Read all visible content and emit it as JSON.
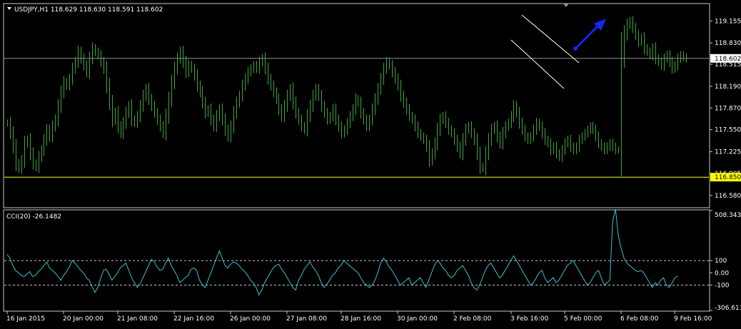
{
  "window": {
    "symbol_header": "USDJPY,H1  118.629 118.630 118.591 118.602",
    "menu_arrow": "triangle-down-icon"
  },
  "colors": {
    "background": "#000000",
    "frame": "#C8C8C8",
    "text": "#FFFFFF",
    "candles": "#3FA33F",
    "cci_line": "#3DBFD0",
    "bid_line": "#8C9199",
    "support_line": "#FFFF00",
    "support_label_bg": "#FFFF00",
    "support_label_text": "#000000",
    "bid_label_bg": "#FFFFFF",
    "bid_label_text": "#000000",
    "channel_lines": "#FFFFFF",
    "arrow": "#1428F0",
    "level_lines": "#C8C8C8"
  },
  "chart_data": [
    {
      "type": "bar",
      "symbol": "USDJPY",
      "timeframe": "H1",
      "ohlc_last": {
        "open": 118.629,
        "high": 118.63,
        "low": 118.591,
        "close": 118.602
      },
      "ylim": [
        116.41,
        119.4
      ],
      "y_ticks": [
        "119.155",
        "118.830",
        "118.515",
        "118.190",
        "117.870",
        "117.550",
        "117.225",
        "116.905",
        "116.580"
      ],
      "y_tick_values": [
        119.155,
        118.83,
        118.515,
        118.19,
        117.87,
        117.55,
        117.225,
        116.905,
        116.58
      ],
      "bid_level": 118.602,
      "bid_label": "118.602",
      "support_level": 116.85,
      "support_label": "116.850",
      "x_ticks": [
        "16 Jan 2015",
        "20 Jan 00:00",
        "21 Jan 08:00",
        "22 Jan 16:00",
        "26 Jan 00:00",
        "27 Jan 08:00",
        "28 Jan 16:00",
        "30 Jan 00:00",
        "2 Feb 08:00",
        "3 Feb 16:00",
        "5 Feb 00:00",
        "6 Feb 08:00",
        "9 Feb 16:00"
      ],
      "x_tick_index": [
        0,
        20,
        39,
        59,
        79,
        99,
        118,
        138,
        158,
        178,
        197,
        217,
        236
      ],
      "bar_count": 248,
      "series_close": [
        117.65,
        117.5,
        117.3,
        117.05,
        116.98,
        117.1,
        117.35,
        117.4,
        117.2,
        117.05,
        117.0,
        117.15,
        117.25,
        117.4,
        117.55,
        117.45,
        117.6,
        117.7,
        117.9,
        118.1,
        118.25,
        118.2,
        118.3,
        118.45,
        118.55,
        118.7,
        118.6,
        118.5,
        118.4,
        118.6,
        118.75,
        118.7,
        118.65,
        118.55,
        118.45,
        118.2,
        117.95,
        117.7,
        117.8,
        117.6,
        117.5,
        117.65,
        117.8,
        117.9,
        117.7,
        117.65,
        117.75,
        117.9,
        118.05,
        118.15,
        118.0,
        117.9,
        117.8,
        117.7,
        117.6,
        117.5,
        117.75,
        118.0,
        118.25,
        118.45,
        118.6,
        118.7,
        118.55,
        118.4,
        118.5,
        118.45,
        118.35,
        118.2,
        118.1,
        117.95,
        117.8,
        117.85,
        117.7,
        117.6,
        117.75,
        117.85,
        117.7,
        117.55,
        117.45,
        117.6,
        117.8,
        117.95,
        118.05,
        118.2,
        118.3,
        118.4,
        118.45,
        118.5,
        118.45,
        118.55,
        118.6,
        118.45,
        118.3,
        118.2,
        118.1,
        118.0,
        117.85,
        117.75,
        117.9,
        118.05,
        118.15,
        117.95,
        117.8,
        117.7,
        117.6,
        117.55,
        117.75,
        117.9,
        118.05,
        118.15,
        118.05,
        117.9,
        117.8,
        117.7,
        117.75,
        117.85,
        117.7,
        117.6,
        117.5,
        117.55,
        117.65,
        117.75,
        117.85,
        118.0,
        117.95,
        117.8,
        117.7,
        117.6,
        117.7,
        117.85,
        118.0,
        118.15,
        118.3,
        118.45,
        118.55,
        118.5,
        118.4,
        118.3,
        118.2,
        118.05,
        117.95,
        117.85,
        117.75,
        117.7,
        117.6,
        117.5,
        117.45,
        117.4,
        117.3,
        117.1,
        117.2,
        117.35,
        117.55,
        117.7,
        117.75,
        117.65,
        117.55,
        117.5,
        117.4,
        117.3,
        117.2,
        117.4,
        117.55,
        117.6,
        117.5,
        117.4,
        117.2,
        117.0,
        116.98,
        117.2,
        117.4,
        117.55,
        117.6,
        117.45,
        117.35,
        117.5,
        117.6,
        117.65,
        117.75,
        117.9,
        117.8,
        117.65,
        117.55,
        117.45,
        117.4,
        117.45,
        117.55,
        117.65,
        117.6,
        117.5,
        117.4,
        117.35,
        117.25,
        117.3,
        117.2,
        117.15,
        117.25,
        117.35,
        117.4,
        117.3,
        117.25,
        117.3,
        117.4,
        117.45,
        117.5,
        117.55,
        117.6,
        117.55,
        117.45,
        117.35,
        117.3,
        117.25,
        117.3,
        117.35,
        117.3,
        117.25,
        117.25,
        118.6,
        118.95,
        119.1,
        119.15,
        119.05,
        118.95,
        118.85,
        118.9,
        118.75,
        118.7,
        118.65,
        118.75,
        118.6,
        118.55,
        118.5,
        118.6,
        118.65,
        118.55,
        118.45,
        118.5,
        118.6,
        118.65,
        118.62,
        118.6
      ]
    },
    {
      "type": "line",
      "indicator": "CCI",
      "period": 20,
      "title": "CCI(20) -26.1482",
      "ylim": [
        -306.6117,
        508.3437
      ],
      "y_ticks": [
        "508.3437",
        "100",
        "0.00",
        "-100",
        "-306.6117"
      ],
      "y_tick_values": [
        508.3437,
        100,
        0,
        -100,
        -306.6117
      ],
      "levels": [
        100,
        -100
      ],
      "series_values": [
        150,
        120,
        60,
        20,
        0,
        -20,
        -30,
        -10,
        10,
        -30,
        -20,
        10,
        30,
        60,
        90,
        40,
        20,
        0,
        -30,
        -60,
        -20,
        10,
        50,
        100,
        80,
        50,
        20,
        0,
        -40,
        -60,
        -110,
        -160,
        -120,
        -50,
        20,
        30,
        -10,
        -60,
        -30,
        0,
        40,
        60,
        80,
        20,
        -40,
        -80,
        -120,
        -90,
        -40,
        10,
        60,
        110,
        90,
        50,
        20,
        30,
        80,
        120,
        60,
        20,
        -20,
        -80,
        -60,
        -40,
        -20,
        30,
        40,
        20,
        -60,
        -100,
        -120,
        -60,
        0,
        60,
        120,
        180,
        120,
        60,
        40,
        70,
        90,
        80,
        60,
        30,
        10,
        -20,
        -60,
        -80,
        -120,
        -180,
        -140,
        -80,
        -40,
        0,
        40,
        60,
        70,
        30,
        0,
        -40,
        -80,
        -120,
        -140,
        -60,
        -20,
        30,
        60,
        90,
        50,
        20,
        -20,
        -80,
        -120,
        -90,
        -60,
        -20,
        0,
        40,
        60,
        100,
        80,
        60,
        40,
        20,
        0,
        -40,
        -80,
        -100,
        -120,
        -100,
        -60,
        0,
        80,
        120,
        90,
        50,
        20,
        -20,
        -60,
        -100,
        -80,
        -60,
        -40,
        -100,
        -80,
        -60,
        -40,
        -80,
        -120,
        -60,
        0,
        60,
        100,
        80,
        40,
        20,
        -20,
        -40,
        -20,
        20,
        40,
        60,
        20,
        -20,
        -80,
        -120,
        -140,
        -100,
        -40,
        20,
        60,
        80,
        40,
        0,
        -40,
        -20,
        20,
        60,
        100,
        140,
        100,
        60,
        20,
        -20,
        -60,
        -100,
        -80,
        -40,
        0,
        20,
        -40,
        -80,
        -60,
        -40,
        -80,
        -60,
        -20,
        20,
        60,
        80,
        100,
        60,
        20,
        -20,
        -60,
        -100,
        -80,
        -40,
        0,
        20,
        -40,
        -100,
        -80,
        -60,
        420,
        520,
        300,
        200,
        120,
        80,
        60,
        40,
        20,
        10,
        20,
        0,
        -40,
        -80,
        -120,
        -80,
        -100,
        -60,
        -40,
        -100,
        -120,
        -80,
        -40,
        -26
      ]
    }
  ]
}
